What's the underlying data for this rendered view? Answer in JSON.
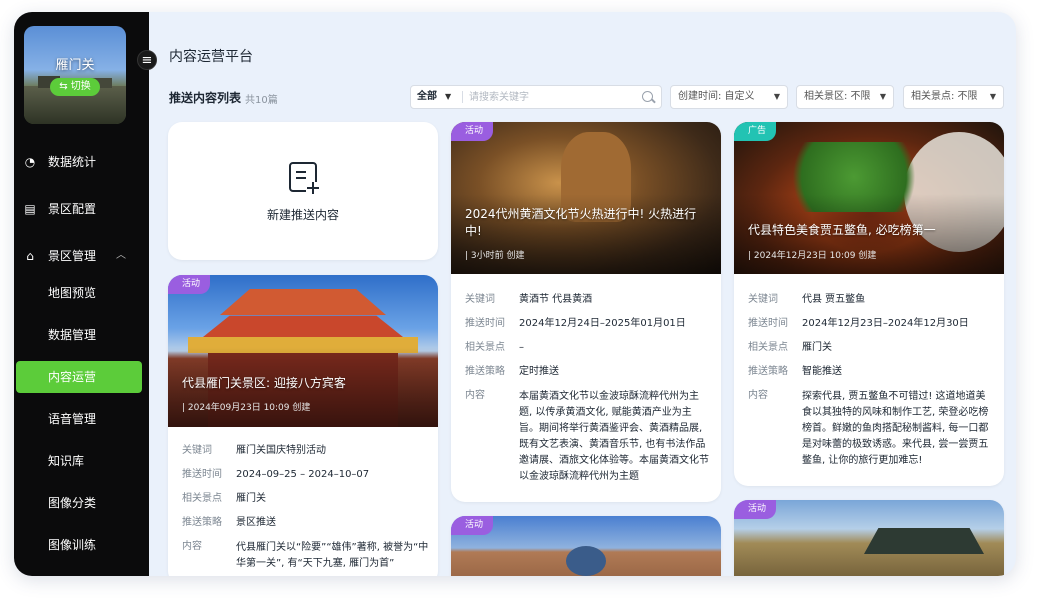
{
  "sidebar": {
    "brand_name": "雁门关",
    "switch_label": "切换",
    "nav": [
      {
        "label": "数据统计",
        "icon": "pie-chart-icon"
      },
      {
        "label": "景区配置",
        "icon": "settings-panel-icon"
      },
      {
        "label": "景区管理",
        "icon": "bank-icon"
      }
    ],
    "sub": [
      {
        "label": "地图预览"
      },
      {
        "label": "数据管理"
      },
      {
        "label": "内容运营"
      },
      {
        "label": "语音管理"
      },
      {
        "label": "知识库"
      },
      {
        "label": "图像分类"
      },
      {
        "label": "图像训练"
      }
    ],
    "active_color": "#5ccc3a"
  },
  "header": {
    "title": "内容运营平台",
    "list_title": "推送内容列表",
    "list_count": "共10篇"
  },
  "filters": {
    "scope": "全部",
    "search_placeholder": "请搜索关键字",
    "created_time": "创建时间: 自定义",
    "related_area": "相关景区: 不限",
    "related_spot": "相关景点: 不限"
  },
  "new_card": {
    "label": "新建推送内容"
  },
  "field_keys": {
    "keywords": "关键词",
    "push_time": "推送时间",
    "spot": "相关景点",
    "strategy": "推送策略",
    "content": "内容"
  },
  "cards": [
    {
      "tag": "活动",
      "title": "代县雁门关景区: 迎接八方宾客",
      "meta": "2024年09月23日 10:09 创建",
      "keywords": "雁门关国庆特别活动",
      "push_time": "2024–09–25 – 2024–10–07",
      "spot": "雁门关",
      "strategy": "景区推送",
      "content": "代县雁门关以“险要”“雄伟”著称, 被誉为“中华第一关”, 有“天下九塞, 雁门为首”"
    },
    {
      "tag": "活动",
      "title": "2024代州黄酒文化节火热进行中! 火热进行中!",
      "meta": "3小时前 创建",
      "keywords": "黄酒节  代县黄酒",
      "push_time": "2024年12月24日–2025年01月01日",
      "spot": "–",
      "strategy": "定时推送",
      "content": "本届黄酒文化节以金波琼酥流粹代州为主题, 以传承黄酒文化, 赋能黄酒产业为主旨。期间将举行黄酒鉴评会、黄酒精品展, 既有文艺表演、黄酒音乐节, 也有书法作品邀请展、酒旅文化体验等。本届黄酒文化节以金波琼酥流粹代州为主题"
    },
    {
      "tag": "广告",
      "title": "代县特色美食贾五鳖鱼, 必吃榜第一",
      "meta": "2024年12月23日 10:09 创建",
      "keywords": "代县  贾五鳖鱼",
      "push_time": "2024年12月23日–2024年12月30日",
      "spot": "雁门关",
      "strategy": "智能推送",
      "content": "探索代县, 贾五鳖鱼不可错过! 这道地道美食以其独特的风味和制作工艺, 荣登必吃榜榜首。鲜嫩的鱼肉搭配秘制酱料, 每一口都是对味蕾的极致诱惑。来代县, 尝一尝贾五鳖鱼, 让你的旅行更加难忘!"
    },
    {
      "tag": "活动"
    },
    {
      "tag": "活动"
    }
  ]
}
